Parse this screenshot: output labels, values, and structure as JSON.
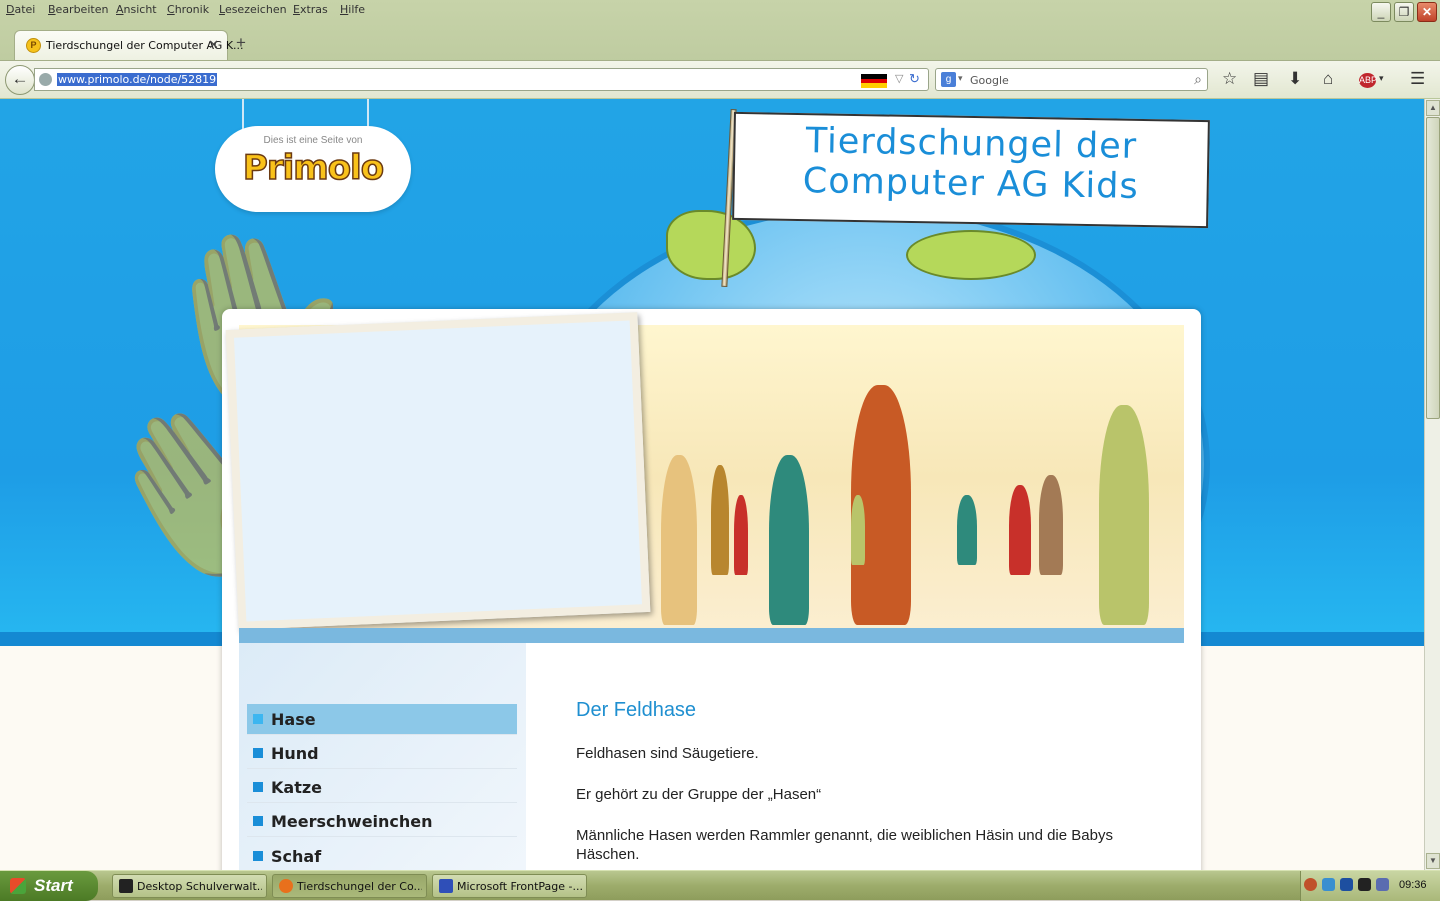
{
  "browser": {
    "menu": [
      "Datei",
      "Bearbeiten",
      "Ansicht",
      "Chronik",
      "Lesezeichen",
      "Extras",
      "Hilfe"
    ],
    "tab_title": "Tierdschungel der Computer AG K...",
    "url": "www.primolo.de/node/52819",
    "search_placeholder": "Google"
  },
  "page": {
    "logo_pretext": "Dies ist eine Seite von",
    "logo_brand": "Primolo",
    "banner_line1": "Tierdschungel der",
    "banner_line2": "Computer AG Kids",
    "nav": [
      {
        "label": "Hase",
        "active": true
      },
      {
        "label": "Hund",
        "active": false
      },
      {
        "label": "Katze",
        "active": false
      },
      {
        "label": "Meerschweinchen",
        "active": false
      },
      {
        "label": "Schaf",
        "active": false
      }
    ],
    "article": {
      "heading": "Der Feldhase",
      "paragraphs": [
        "Feldhasen sind Säugetiere.",
        "Er gehört zu der Gruppe der „Hasen“",
        "Männliche Hasen werden Rammler genannt, die weiblichen Häsin und die Babys Häschen."
      ]
    }
  },
  "taskbar": {
    "start_label": "Start",
    "buttons": [
      {
        "label": "Desktop Schulverwalt..."
      },
      {
        "label": "Tierdschungel der Co..."
      },
      {
        "label": "Microsoft FrontPage -..."
      }
    ],
    "clock": "09:36"
  },
  "colors": {
    "accent": "#1a8ed8",
    "sky": "#22a4e6",
    "active_nav": "#8cc8e8"
  }
}
